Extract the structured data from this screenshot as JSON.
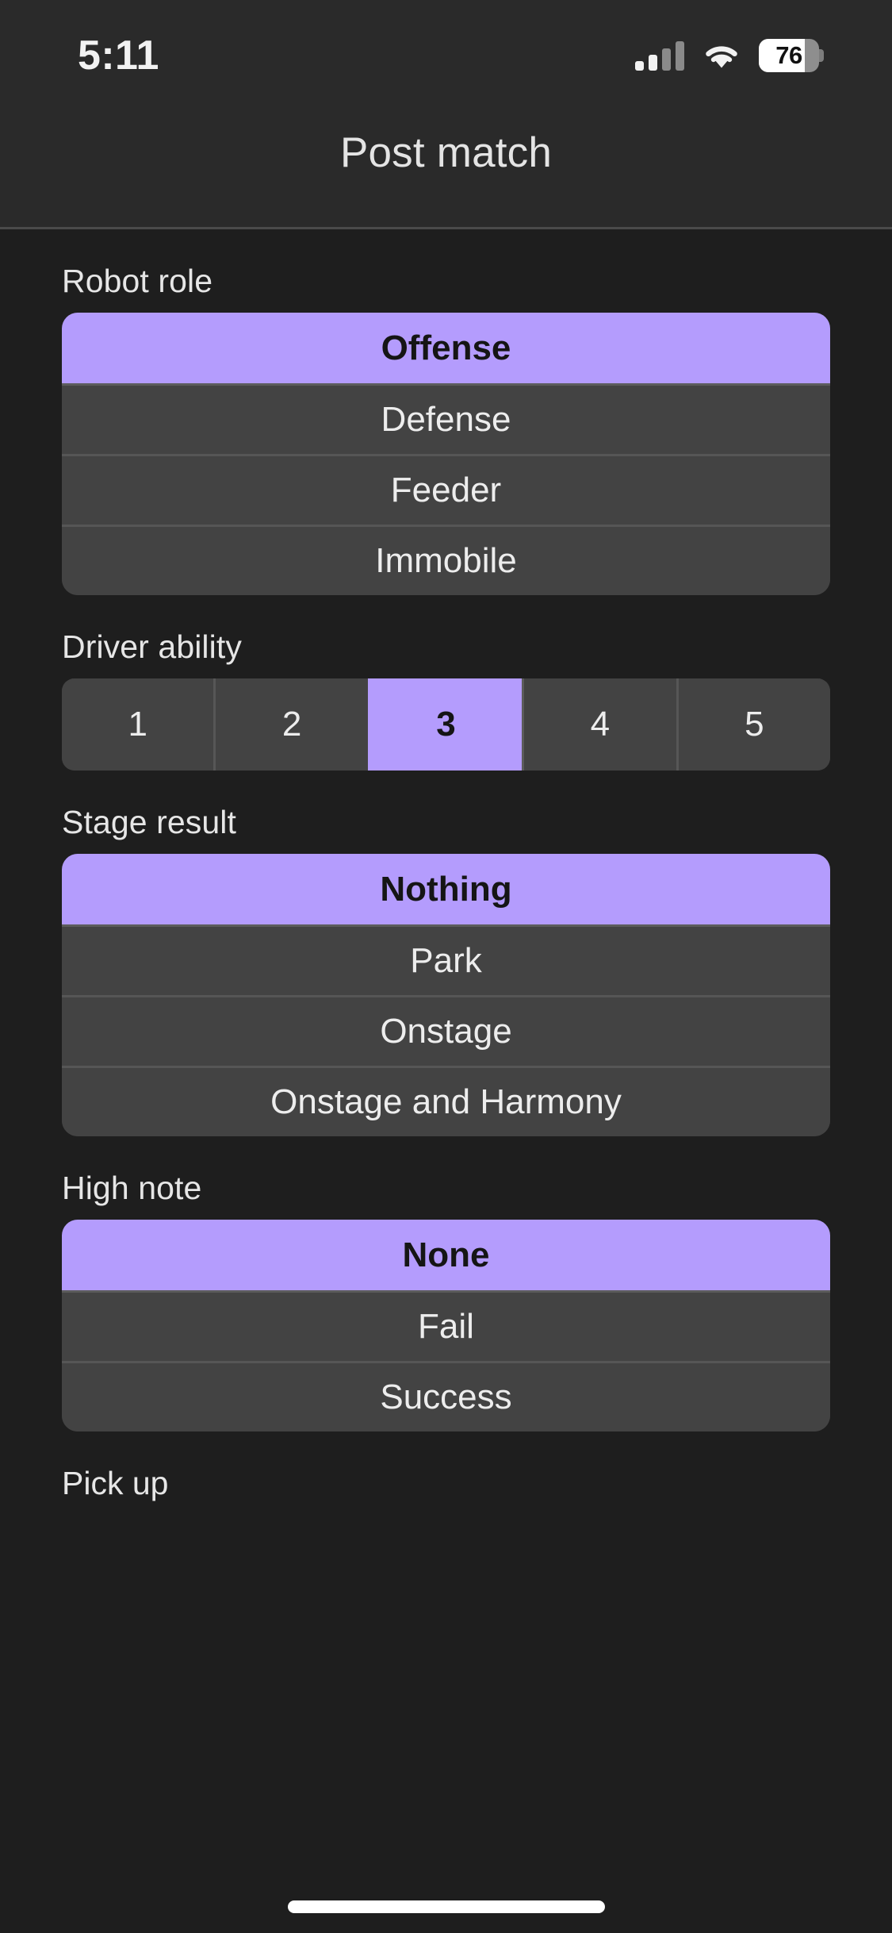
{
  "status_bar": {
    "time": "5:11",
    "battery_percent": "76",
    "battery_level": 76,
    "cellular_bars_active": 2,
    "cellular_bars_total": 4,
    "icons": [
      "cellular-signal-icon",
      "wifi-icon",
      "battery-icon"
    ]
  },
  "header": {
    "title": "Post match"
  },
  "theme": {
    "accent": "#b49cfd",
    "background": "#1e1e1e",
    "surface": "#434343",
    "header_background": "#2a2a2a",
    "separator": "#565656",
    "text_primary": "#ededed",
    "text_on_accent": "#151515"
  },
  "sections": [
    {
      "key": "robot_role",
      "label": "Robot role",
      "style": "vertical",
      "options": [
        "Offense",
        "Defense",
        "Feeder",
        "Immobile"
      ],
      "selected": "Offense",
      "selected_index": 0
    },
    {
      "key": "driver_ability",
      "label": "Driver ability",
      "style": "segmented",
      "options": [
        "1",
        "2",
        "3",
        "4",
        "5"
      ],
      "selected": "3",
      "selected_index": 2
    },
    {
      "key": "stage_result",
      "label": "Stage result",
      "style": "vertical",
      "options": [
        "Nothing",
        "Park",
        "Onstage",
        "Onstage and Harmony"
      ],
      "selected": "Nothing",
      "selected_index": 0
    },
    {
      "key": "high_note",
      "label": "High note",
      "style": "vertical",
      "options": [
        "None",
        "Fail",
        "Success"
      ],
      "selected": "None",
      "selected_index": 0
    }
  ],
  "partial_section": {
    "key": "pick_up",
    "label": "Pick up"
  }
}
